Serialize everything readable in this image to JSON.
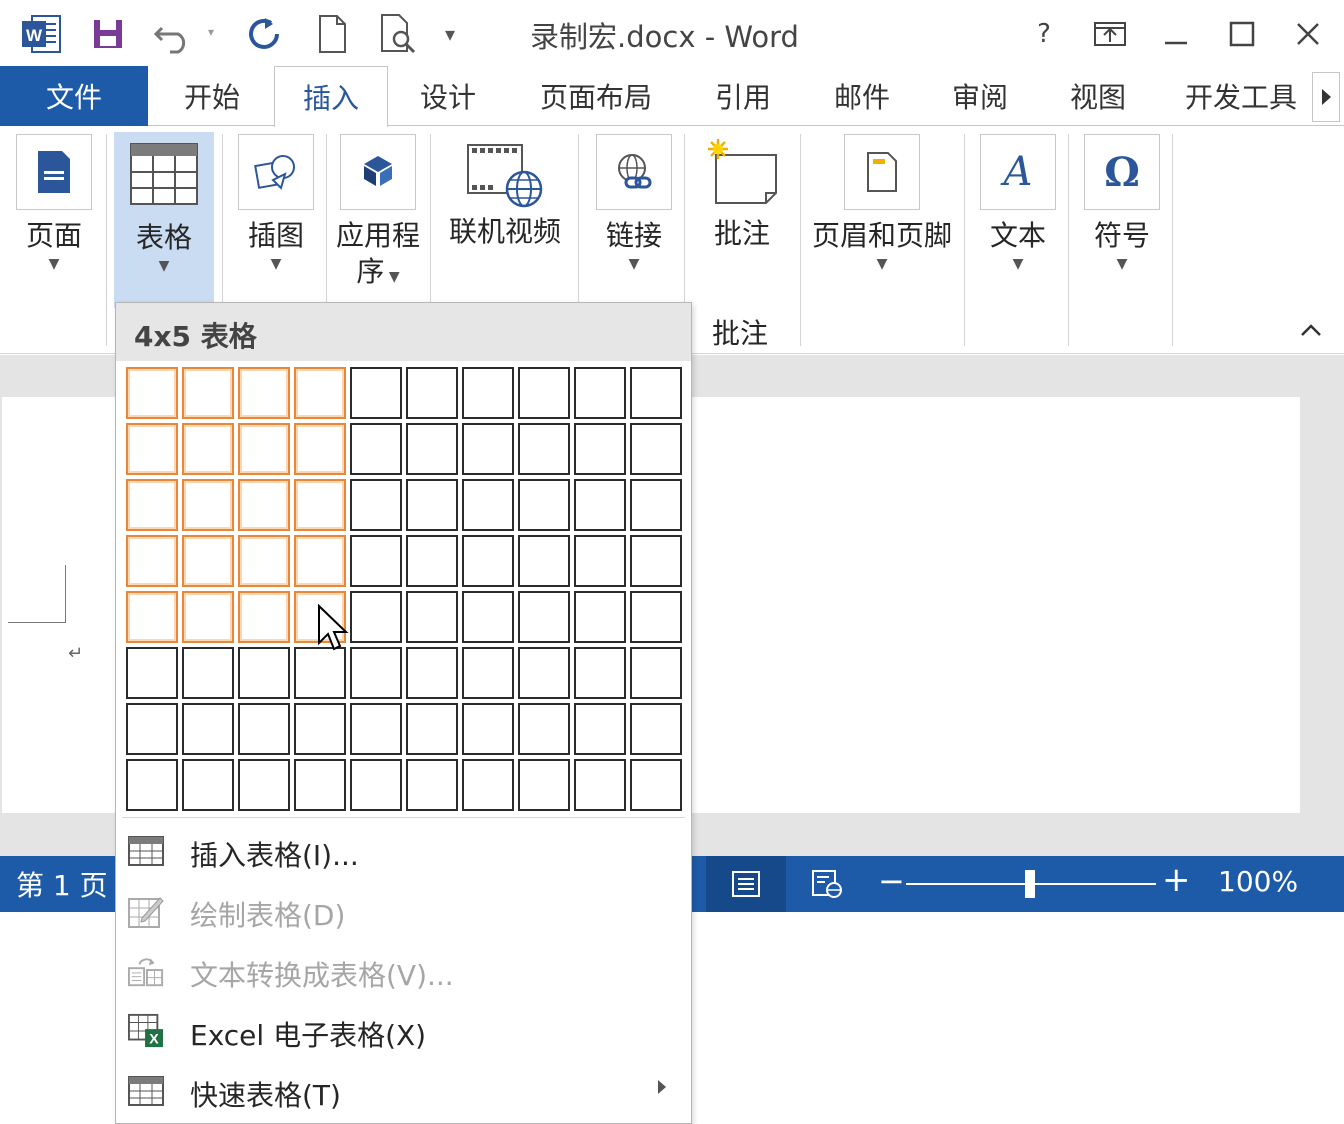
{
  "window": {
    "title": "录制宏.docx - Word",
    "help": "?",
    "accent": "#1d5ba9"
  },
  "quick_access": [
    {
      "name": "word-logo-icon"
    },
    {
      "name": "save-icon"
    },
    {
      "name": "undo-icon"
    },
    {
      "name": "redo-icon"
    },
    {
      "name": "new-document-icon"
    },
    {
      "name": "print-preview-icon"
    },
    {
      "name": "customize-toolbar-icon"
    }
  ],
  "tabs": {
    "file": "文件",
    "items": [
      "开始",
      "插入",
      "设计",
      "页面布局",
      "引用",
      "邮件",
      "审阅",
      "视图",
      "开发工具"
    ],
    "active": "插入"
  },
  "ribbon": {
    "page": "页面",
    "table": "表格",
    "illustrations": "插图",
    "apps_line1": "应用程",
    "apps_line2": "序",
    "online_video": "联机视频",
    "link": "链接",
    "comment": "批注",
    "header_footer": "页眉和页脚",
    "text": "文本",
    "symbols": "符号",
    "group_comments": "批注"
  },
  "dropdown": {
    "header": "4x5 表格",
    "grid": {
      "columns": 10,
      "rows": 8,
      "selected_columns": 4,
      "selected_rows": 5
    },
    "items": [
      {
        "label": "插入表格(I)...",
        "enabled": true,
        "icon": "insert-table-icon"
      },
      {
        "label": "绘制表格(D)",
        "enabled": false,
        "icon": "draw-table-icon"
      },
      {
        "label": "文本转换成表格(V)...",
        "enabled": false,
        "icon": "convert-text-icon"
      },
      {
        "label": "Excel 电子表格(X)",
        "enabled": true,
        "icon": "excel-icon"
      },
      {
        "label": "快速表格(T)",
        "enabled": true,
        "icon": "quick-tables-icon",
        "submenu": true
      }
    ]
  },
  "statusbar": {
    "page": "第 1 页",
    "zoom": "100%"
  }
}
